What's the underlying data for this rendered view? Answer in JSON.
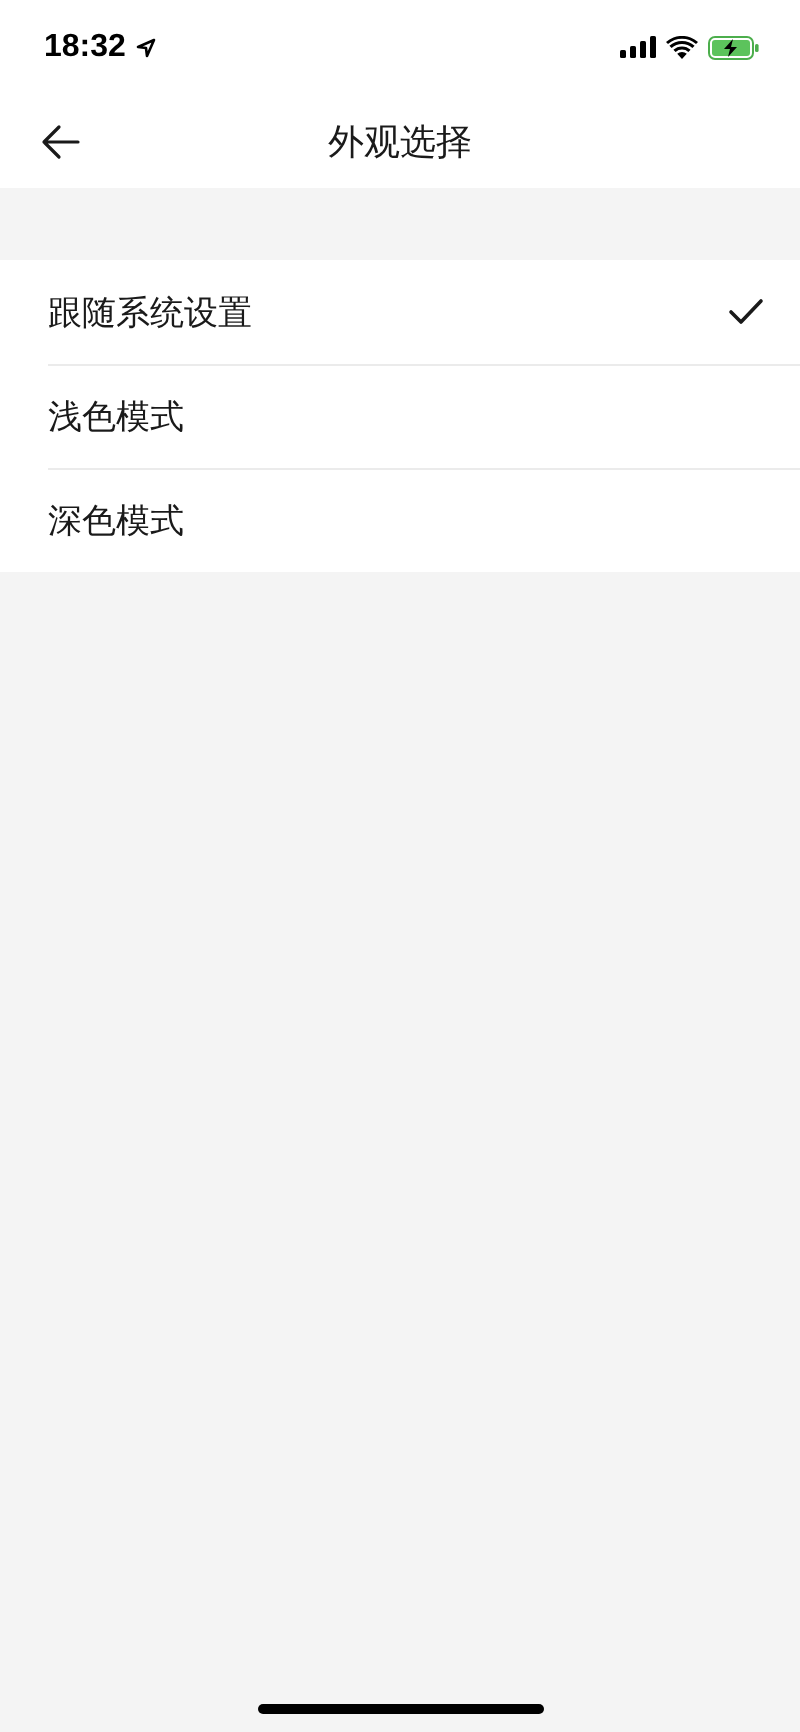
{
  "status_bar": {
    "time": "18:32"
  },
  "nav": {
    "title": "外观选择"
  },
  "options": [
    {
      "label": "跟随系统设置",
      "selected": true
    },
    {
      "label": "浅色模式",
      "selected": false
    },
    {
      "label": "深色模式",
      "selected": false
    }
  ]
}
